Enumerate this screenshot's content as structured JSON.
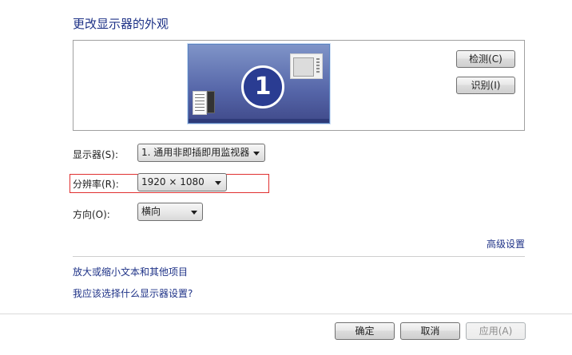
{
  "title": "更改显示器的外观",
  "preview": {
    "monitor_number": "1",
    "detect_label": "检测(C)",
    "identify_label": "识别(I)"
  },
  "display": {
    "label": "显示器(S):",
    "value": "1. 通用非即插即用监视器"
  },
  "resolution": {
    "label": "分辨率(R):",
    "value": "1920 × 1080"
  },
  "orientation": {
    "label": "方向(O):",
    "value": "横向"
  },
  "advanced_link": "高级设置",
  "links": {
    "text_size": "放大或缩小文本和其他项目",
    "which_settings": "我应该选择什么显示器设置?"
  },
  "footer": {
    "ok": "确定",
    "cancel": "取消",
    "apply": "应用(A)"
  },
  "colors": {
    "accent": "#1e3287",
    "highlight_border": "#e03030"
  }
}
